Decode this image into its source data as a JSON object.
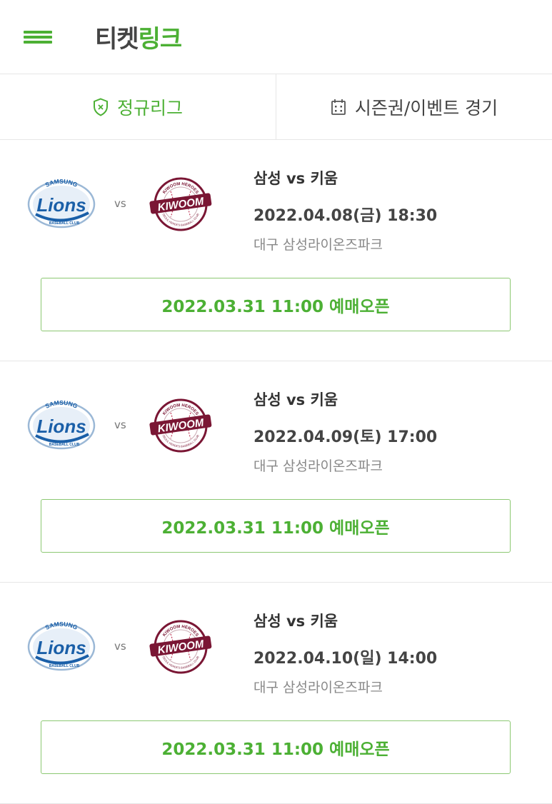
{
  "header": {
    "logo_part1": "티켓",
    "logo_part2": "링크"
  },
  "tabs": [
    {
      "label": "정규리그",
      "active": true
    },
    {
      "label": "시즌권/이벤트 경기",
      "active": false
    }
  ],
  "vs_label": "vs",
  "games": [
    {
      "teams": "삼성 vs 키움",
      "datetime": "2022.04.08(금) 18:30",
      "venue": "대구 삼성라이온즈파크",
      "open_label": "2022.03.31 11:00 예매오픈"
    },
    {
      "teams": "삼성 vs 키움",
      "datetime": "2022.04.09(토) 17:00",
      "venue": "대구 삼성라이온즈파크",
      "open_label": "2022.03.31 11:00 예매오픈"
    },
    {
      "teams": "삼성 vs 키움",
      "datetime": "2022.04.10(일) 14:00",
      "venue": "대구 삼성라이온즈파크",
      "open_label": "2022.03.31 11:00 예매오픈"
    }
  ],
  "logos": {
    "home": {
      "top": "SAMSUNG",
      "main": "Lions",
      "bottom": "BASEBALL CLUB"
    },
    "away": {
      "top": "KIWOOM HEROES",
      "main": "KIWOOM",
      "bottom": "SEOUL HEROES BASEBALL CLUB"
    }
  },
  "colors": {
    "accent": "#4cb034",
    "lions_blue": "#1a5fa8",
    "kiwoom_maroon": "#7a1634"
  }
}
